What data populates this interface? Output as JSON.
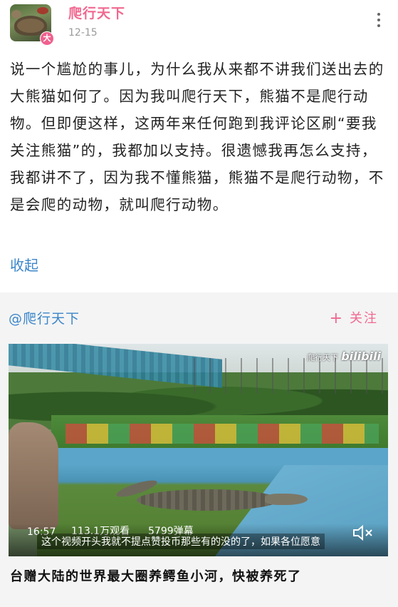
{
  "post": {
    "username": "爬行天下",
    "level_badge": "大",
    "date": "12-15",
    "text": "说一个尴尬的事儿，为什么我从来都不讲我们送出去的大熊猫如何了。因为我叫爬行天下，熊猫不是爬行动物。但即便这样，这两年来任何跑到我评论区刷“要我关注熊猫”的，我都加以支持。很遗憾我再怎么支持，我都讲不了，因为我不懂熊猫，熊猫不是爬行动物，不是会爬的动物，就叫爬行动物。",
    "collapse_label": "收起"
  },
  "shared_card": {
    "mention": "@爬行天下",
    "follow_plus": "+",
    "follow_label": "关注",
    "video": {
      "watermark_user": "爬行天下",
      "watermark_logo": "bilibili",
      "duration": "16:57",
      "views": "113.1万观看",
      "danmaku": "5799弹幕",
      "subtitle": "这个视频开头我就不提点赞投币那些有的没的了，如果各位愿意"
    },
    "title": "台赠大陆的世界最大圈养鳄鱼小河，快被养死了"
  },
  "colors": {
    "username": "#f06890",
    "link": "#3b86c9",
    "follow": "#f06890",
    "card_bg": "#f4f4f4"
  },
  "icons": [
    "more-vertical-icon",
    "mute-icon"
  ]
}
